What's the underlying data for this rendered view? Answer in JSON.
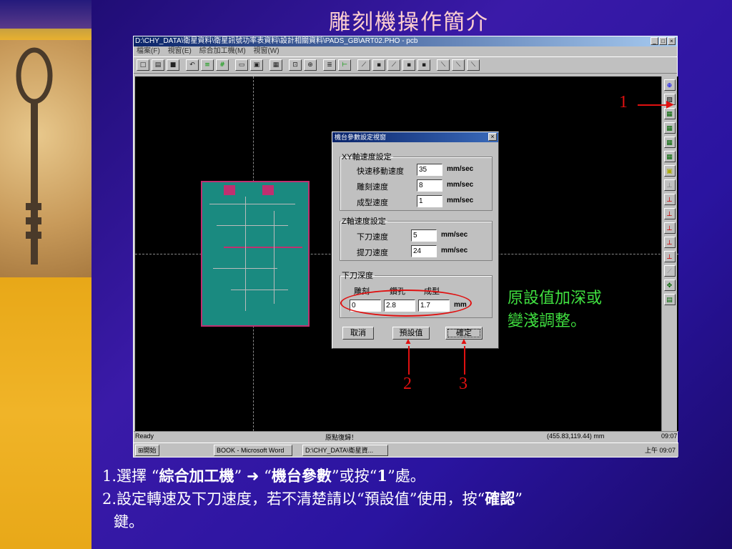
{
  "slide_title": "雕刻機操作簡介",
  "window": {
    "title": "D:\\CHY_DATA\\衛星資料\\衛星訊號功率表資料\\設計相關資料\\PADS_GB\\ART02.PHO - pcb",
    "menu": [
      "檔案(F)",
      "視窗(E)",
      "綜合加工機(M)",
      "視窗(W)"
    ],
    "min_label": "_",
    "max_label": "□",
    "close_label": "×"
  },
  "toolbar_icons": [
    "new-icon",
    "open-icon",
    "save-icon",
    "undo-icon",
    "layer-icon",
    "grid-icon",
    "rect-icon",
    "rect2-icon",
    "calc-icon",
    "zoom-icon",
    "zoom2-icon",
    "ruler-icon",
    "measure-icon",
    "drill-icon",
    "drill2-icon",
    "drill3-icon",
    "drill4-icon",
    "drill5-icon",
    "tool-icon",
    "tool2-icon",
    "tool3-icon"
  ],
  "right_toolbar_icons": [
    "home-icon",
    "param-icon",
    "tool-a-icon",
    "tool-b-icon",
    "tool-c-icon",
    "tool-d-icon",
    "tool-e-icon",
    "tool-f-icon",
    "tool-g-icon",
    "tool-h-icon",
    "tool-i-icon",
    "tool-j-icon",
    "tool-k-icon",
    "tool-l-icon",
    "move-icon",
    "misc-icon"
  ],
  "status": {
    "ready": "Ready",
    "msg": "原點復歸！",
    "coords": "(455.83,119.44) mm",
    "time": "09:07"
  },
  "taskbar": {
    "start": "開始",
    "word_task": "BOOK - Microsoft Word",
    "app_task": "D:\\CHY_DATA\\衛星資...",
    "clock": "上午 09:07"
  },
  "dialog": {
    "title": "機台參數設定視窗",
    "close": "×",
    "xy_group": "XY軸速度設定",
    "xy_fast_label": "快速移動速度",
    "xy_fast_value": "35",
    "xy_engrave_label": "雕刻速度",
    "xy_engrave_value": "8",
    "xy_form_label": "成型速度",
    "xy_form_value": "1",
    "z_group": "Z軸速度設定",
    "z_down_label": "下刀速度",
    "z_down_value": "5",
    "z_up_label": "提刀速度",
    "z_up_value": "24",
    "unit_mmsec": "mm/sec",
    "depth_group": "下刀深度",
    "depth_engrave_label": "雕刻",
    "depth_drill_label": "鑽孔",
    "depth_form_label": "成型",
    "depth_engrave_value": "0",
    "depth_drill_value": "2.8",
    "depth_form_value": "1.7",
    "unit_mm": "mm",
    "cancel": "取消",
    "default": "預設值",
    "ok": "確定"
  },
  "annotations": {
    "label1": "1",
    "label2": "2",
    "label3": "3",
    "note_line1": "原設值加深或",
    "note_line2": "變淺調整。"
  },
  "instructions": {
    "l1_pre": "1.選擇 “",
    "l1_b1": "綜合加工機",
    "l1_mid": "” ➜ “",
    "l1_b2": "機台參數",
    "l1_post": "”或按“",
    "l1_b3": "1",
    "l1_end": "”處。",
    "l2_a": "2.設定轉速及下刀速度，若不清楚請以“預設值”使用，按“",
    "l2_b": "確認",
    "l2_c": "”",
    "l2_d": "鍵。"
  }
}
